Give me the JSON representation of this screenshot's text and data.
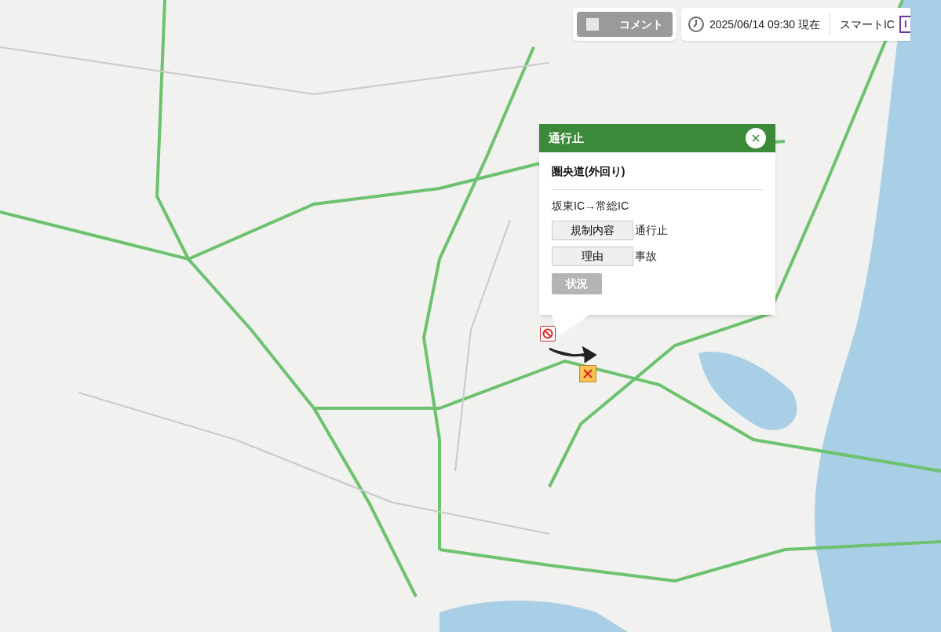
{
  "toolbar": {
    "comment": {
      "label": "コメント",
      "checked": false
    },
    "time": "2025/06/14 09:30 現在",
    "legend": [
      {
        "label": "スマートIC",
        "badge": "I"
      }
    ]
  },
  "popup": {
    "title": "通行止",
    "road": "圏央道(外回り)",
    "section": "坂東IC→常総IC",
    "rows": [
      {
        "label": "規制内容",
        "value": "通行止"
      },
      {
        "label": "理由",
        "value": "事故"
      }
    ],
    "action": {
      "label": "状況",
      "disabled": true
    }
  }
}
